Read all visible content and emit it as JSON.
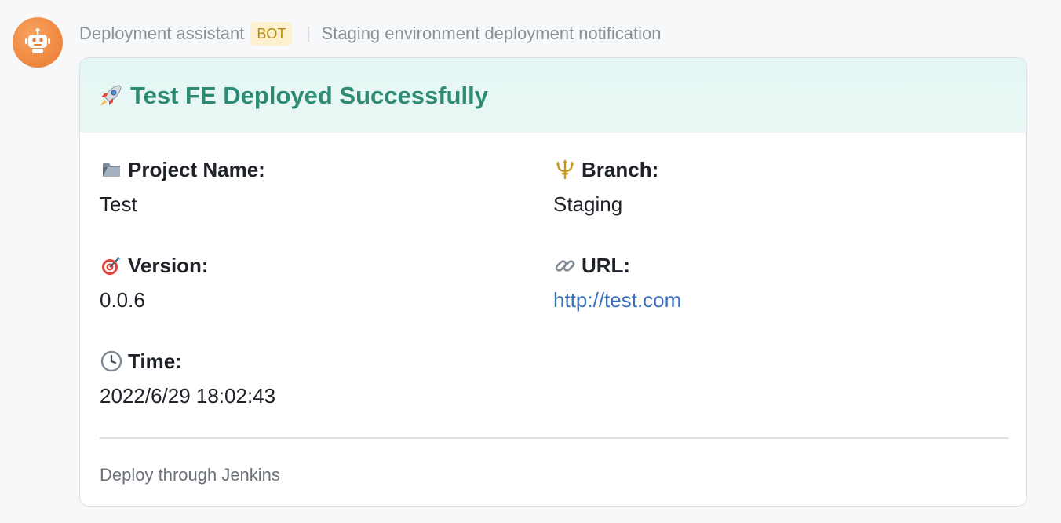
{
  "sender": {
    "name": "Deployment assistant",
    "badge": "BOT",
    "separator": "|",
    "subject": "Staging environment deployment notification",
    "avatar_icon": "robot-icon"
  },
  "card": {
    "header_icon": "rocket-icon",
    "title": "Test FE Deployed Successfully",
    "fields": {
      "project": {
        "icon": "folder-icon",
        "label": "Project Name:",
        "value": "Test"
      },
      "branch": {
        "icon": "trident-icon",
        "label": "Branch:",
        "value": "Staging"
      },
      "version": {
        "icon": "target-icon",
        "label": "Version:",
        "value": "0.0.6"
      },
      "url": {
        "icon": "link-icon",
        "label": "URL:",
        "value": "http://test.com"
      },
      "time": {
        "icon": "clock-icon",
        "label": "Time:",
        "value": "2022/6/29 18:02:43"
      }
    },
    "footer": "Deploy through Jenkins"
  },
  "colors": {
    "accent": "#2d8a74",
    "header_bg": "#e3f6f3",
    "link": "#3a6fc0",
    "badge_bg": "#fcf0cf",
    "badge_text": "#b98a17",
    "avatar": "#ea7a2f"
  }
}
